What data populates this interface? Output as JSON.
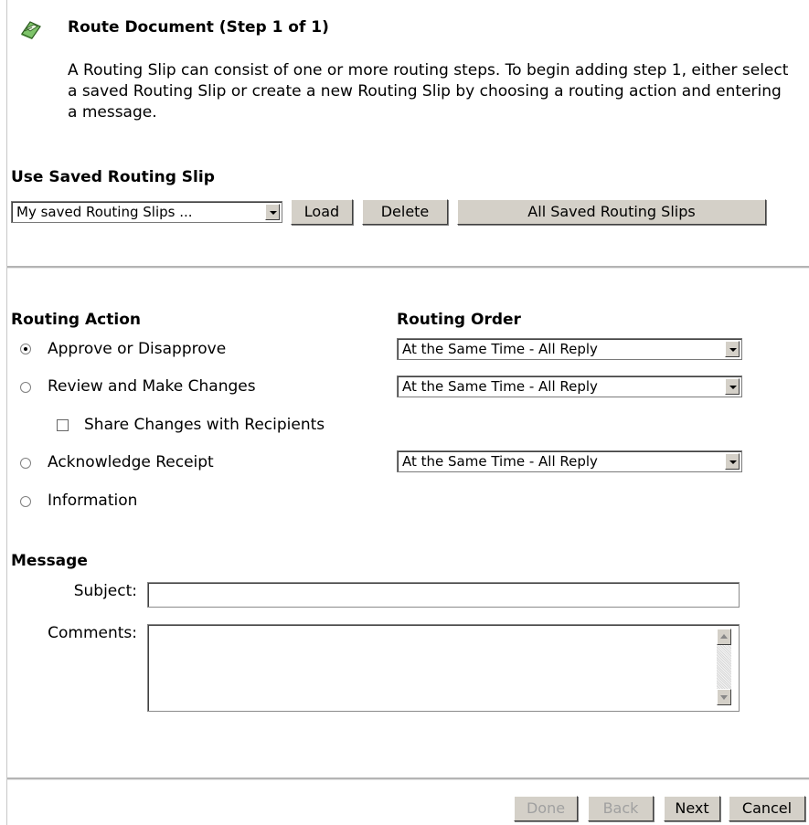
{
  "header": {
    "title": "Route Document (Step 1 of 1)",
    "icon": "route-document-icon",
    "description": "A Routing Slip can consist of one or more routing steps. To begin adding step 1, either select a saved Routing Slip or create a new Routing Slip by choosing a routing action and entering a message."
  },
  "saved_slip": {
    "heading": "Use Saved Routing Slip",
    "select_value": "My saved Routing Slips ...",
    "load_label": "Load",
    "delete_label": "Delete",
    "all_label": "All Saved Routing Slips"
  },
  "routing": {
    "action_heading": "Routing Action",
    "order_heading": "Routing Order",
    "options": [
      {
        "label": "Approve or Disapprove",
        "selected": true,
        "order": "At the Same Time - All Reply"
      },
      {
        "label": "Review and Make Changes",
        "selected": false,
        "order": "At the Same Time - All Reply"
      },
      {
        "label": "Acknowledge Receipt",
        "selected": false,
        "order": "At the Same Time - All Reply"
      },
      {
        "label": "Information",
        "selected": false
      }
    ],
    "share_changes_label": "Share Changes with Recipients",
    "share_changes_checked": false
  },
  "message": {
    "heading": "Message",
    "subject_label": "Subject:",
    "subject_value": "",
    "comments_label": "Comments:",
    "comments_value": ""
  },
  "footer": {
    "done_label": "Done",
    "back_label": "Back",
    "next_label": "Next",
    "cancel_label": "Cancel"
  }
}
